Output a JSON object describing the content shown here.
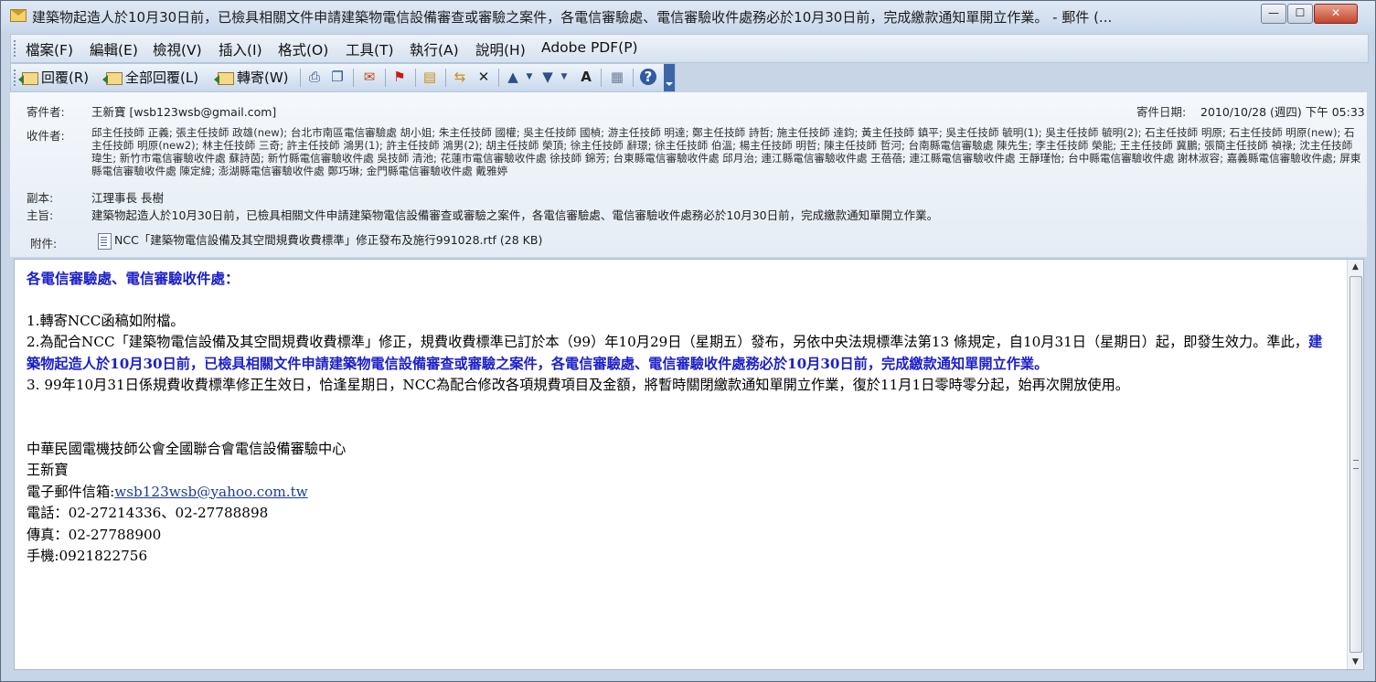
{
  "window": {
    "title": "建築物起造人於10月30日前，已檢具相關文件申請建築物電信設備審查或審驗之案件，各電信審驗處、電信審驗收件處務必於10月30日前，完成繳款通知單開立作業。 - 郵件 (...",
    "minimize": "—",
    "maximize": "☐",
    "close": "✕"
  },
  "menu": [
    "檔案(F)",
    "編輯(E)",
    "檢視(V)",
    "插入(I)",
    "格式(O)",
    "工具(T)",
    "執行(A)",
    "說明(H)",
    "Adobe PDF(P)"
  ],
  "toolbar": {
    "reply": "回覆(R)",
    "reply_all": "全部回覆(L)",
    "forward": "轉寄(W)",
    "icons": [
      "print-icon",
      "copy-icon",
      "mail-icon",
      "flag-icon",
      "folder-icon",
      "move-icon",
      "delete-icon",
      "up-icon",
      "down-icon",
      "font-size-icon",
      "addressbook-icon",
      "help-icon"
    ]
  },
  "header": {
    "from_label": "寄件者:",
    "from": "王新寶 [wsb123wsb@gmail.com]",
    "date_label": "寄件日期:",
    "date": "2010/10/28 (週四) 下午 05:33",
    "to_label": "收件者:",
    "to": "邱主任技師 正義; 張主任技師 政雄(new); 台北市南區電信審驗處 胡小姐; 朱主任技師 國權; 吳主任技師 國楨; 游主任技師 明達; 鄭主任技師 詩哲; 施主任技師 達鈞; 黃主任技師 鎮平; 吳主任技師 毓明(1); 吳主任技師 毓明(2); 石主任技師 明原; 石主任技師 明原(new); 石主任技師 明原(new2); 林主任技師 三奇; 許主任技師 鴻男(1); 許主任技師 鴻男(2); 胡主任技師 榮頂; 徐主任技師 辭璟; 徐主任技師 伯溫; 楊主任技師 明哲; 陳主任技師 哲河; 台南縣電信審驗處 陳先生; 李主任技師 榮能; 王主任技師 冀鵬; 張簡主任技師 禎祿; 沈主任技師 瑋生; 新竹市電信審驗收件處 蘇詩茵; 新竹縣電信審驗收件處 吳技師 清池; 花蓮市電信審驗收件處 徐技師 錦芳; 台東縣電信審驗收件處 邱月治; 連江縣電信審驗收件處 王蓓蓓; 連江縣電信審驗收件處 王靜瑾怡; 台中縣電信審驗收件處 謝林淑容; 嘉義縣電信審驗收件處; 屏東縣電信審驗收件處 陳定緯; 澎湖縣電信審驗收件處 鄭巧琳; 金門縣電信審驗收件處 戴雅婷",
    "cc_label": "副本:",
    "cc": "江理事長 長樹",
    "subject_label": "主旨:",
    "subject": "建築物起造人於10月30日前，已檢具相關文件申請建築物電信設備審查或審驗之案件，各電信審驗處、電信審驗收件處務必於10月30日前，完成繳款通知單開立作業。",
    "attach_label": "附件:",
    "attachment": "NCC「建築物電信設備及其空間規費收費標準」修正發布及施行991028.rtf (28 KB)"
  },
  "body": {
    "greeting": "各電信審驗處、電信審驗收件處：",
    "p1": "1.轉寄NCC函稿如附檔。",
    "p2_start": "2.為配合NCC「建築物電信設備及其空間規費收費標準」修正，規費收費標準已訂於本（99）年10月29日（星期五）發布，另依中央法規標準法第13 條規定，自10月31日（星期日）起，即發生效力。準此，",
    "p2_emph": "建築物起造人於10月30日前，已檢具相關文件申請建築物電信設備審查或審驗之案件，各電信審驗處、電信審驗收件處務必於10月30日前，完成繳款通知單開立作業。",
    "p3": "3. 99年10月31日係規費收費標準修正生效日，恰逢星期日，NCC為配合修改各項規費項目及金額，將暫時關閉繳款通知單開立作業，復於11月1日零時零分起，始再次開放使用。",
    "sig_org": "中華民國電機技師公會全國聯合會電信設備審驗中心",
    "sig_name": "王新寶",
    "sig_email_label": "電子郵件信箱:",
    "sig_email": "wsb123wsb@yahoo.com.tw",
    "sig_phone": "電話：02-27214336、02-27788898",
    "sig_fax": "傳真：02-27788900",
    "sig_mobile": "手機:0921822756"
  }
}
